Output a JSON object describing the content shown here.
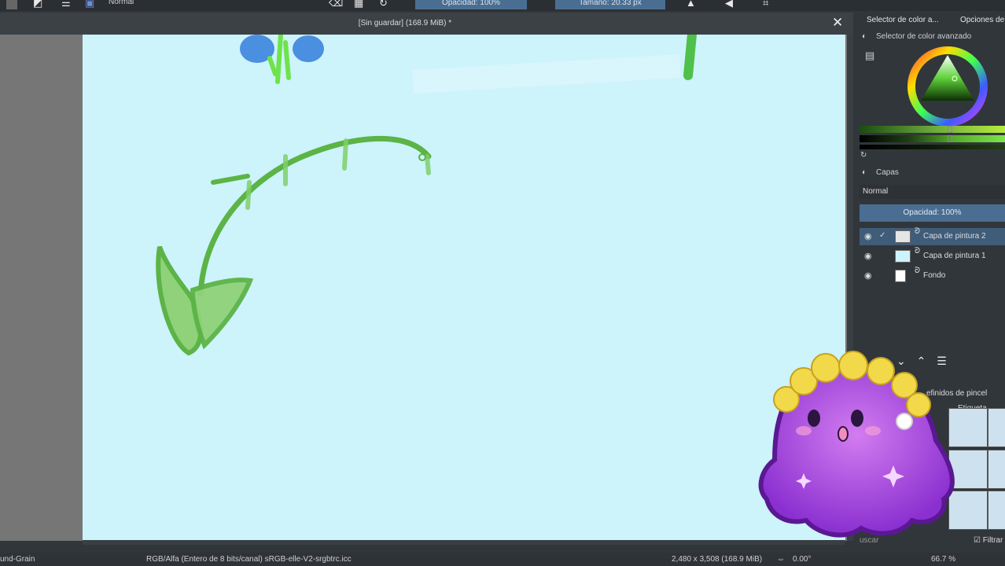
{
  "toolbar": {
    "blend_mode": "Normal",
    "opacity_label": "Opacidad: 100%",
    "size_label": "Tamaño: 20.33 px"
  },
  "document": {
    "title": "[Sin guardar]  (168.9 MiB) *",
    "close_glyph": "✕"
  },
  "dock": {
    "tabs": [
      "Selector de color a...",
      "Opciones de"
    ],
    "advanced_selector_label": "Selector de color avanzado",
    "layers_title": "Capas",
    "blend_mode": "Normal",
    "opacity": "Opacidad:  100%",
    "layers": [
      {
        "name": "Capa de pintura 2",
        "active": true,
        "checked": true
      },
      {
        "name": "Capa de pintura 1",
        "active": false,
        "checked": false
      },
      {
        "name": "Fondo",
        "active": false,
        "checked": false
      }
    ],
    "brush_presets_label": "efinidos de pincel",
    "tag_label": "Etiqueta",
    "filter_label": "Filtrar",
    "search_label": "uscar"
  },
  "statusbar": {
    "brush_name": "und-Grain",
    "color_space": "RGB/Alfa (Entero de 8 bits/canal)  sRGB-elle-V2-srgbtrc.icc",
    "image_size": "2,480 x 3,508 (168.9 MiB)",
    "rotation": "0.00°",
    "zoom": "66.7 %"
  },
  "colors": {
    "canvas_bg": "#cdf3fb",
    "stroke_green": "#5cb346",
    "flower_blue": "#4a8fe0",
    "accent": "#4a6e92",
    "mascot_purple": "#a34fe0"
  }
}
